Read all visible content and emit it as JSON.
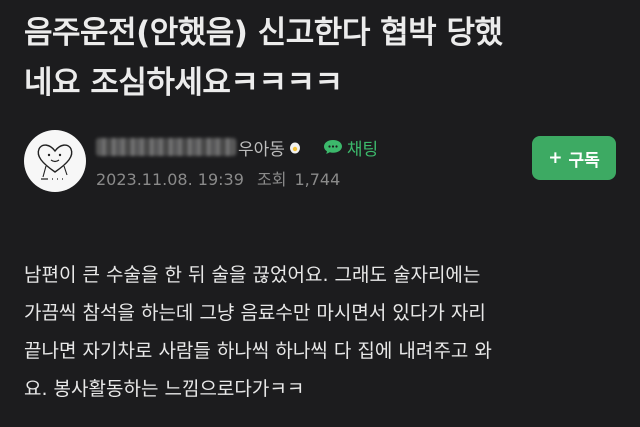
{
  "post": {
    "title_line1": "음주운전(안했음) 신고한다 협박 당했",
    "title_line2": "네요 조심하세요ㅋㅋㅋㅋ"
  },
  "author": {
    "nickname_suffix": "우아동",
    "chat_label": "채팅",
    "date": "2023.11.08. 19:39",
    "views_label": "조회",
    "views": "1,744"
  },
  "subscribe": {
    "icon": "+",
    "label": "구독"
  },
  "body": {
    "lines": [
      "남편이 큰 수술을 한 뒤 술을 끊었어요. 그래도 술자리에는",
      "가끔씩 참석을 하는데 그냥 음료수만 마시면서 있다가 자리",
      "끝나면 자기차로 사람들 하나씩 하나씩 다 집에 내려주고 와",
      "요. 봉사활동하는 느낌으로다가ㅋㅋ"
    ]
  },
  "colors": {
    "background": "#1c1c1e",
    "accent_green": "#3daa63",
    "chat_green": "#3cb86b"
  },
  "icons": {
    "egg": "egg-icon",
    "chat": "chat-bubble-icon",
    "avatar": "heart-doodle-avatar"
  }
}
